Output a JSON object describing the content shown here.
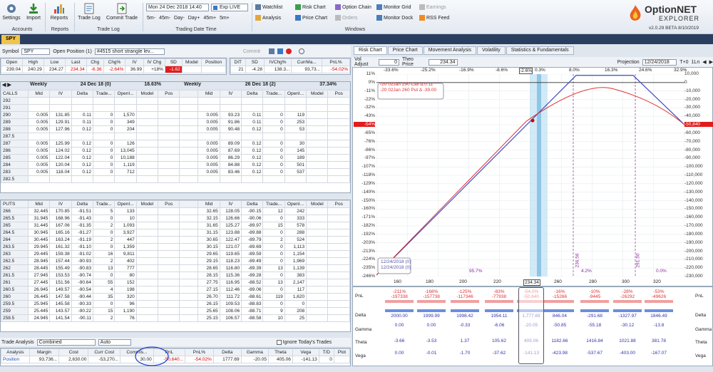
{
  "ribbon": {
    "accounts": {
      "group": "Accounts",
      "settings": "Settings",
      "import": "Import"
    },
    "reports": {
      "group": "Reports",
      "reports": "Reports"
    },
    "tradelog": {
      "group": "Trade Log",
      "tradelog": "Trade Log",
      "committrade": "Commit Trade"
    },
    "tradingdate": {
      "group": "Trading Date  Time",
      "date": "Mon 24 Dec 2018 14:40",
      "exp": "Exp LIVE",
      "steps": [
        "5m-",
        "45m-",
        "Day-",
        "Day+",
        "45m+",
        "5m+"
      ]
    },
    "windows": {
      "group": "Windows",
      "items": [
        "Watchlist",
        "Analysis",
        "Risk Chart",
        "Price Chart",
        "Option Chain",
        "Orders",
        "Monitor Grid",
        "Monitor Dock",
        "Earnings",
        "RSS Feed"
      ]
    },
    "brand": {
      "line1": "OptionNET",
      "line2": "EXPLORER",
      "version": "v2.0.29 BETA 8/10/2019"
    }
  },
  "tab": "SPY",
  "symbolbar": {
    "symbol_label": "Symbol",
    "symbol": "SPY",
    "open_position_label": "Open Position (1)",
    "position": "#4515 short strangle lev...",
    "commit": "Commit"
  },
  "quote": {
    "headers": [
      "Open",
      "High",
      "Low",
      "Last",
      "Chg",
      "Chg%",
      "IV",
      "IV Chg",
      "SD",
      "Model",
      "Position"
    ],
    "values": [
      "239.04",
      "240.29",
      "234.27",
      "234.34",
      "-6.36",
      "-2.64%",
      "36.99",
      "+18%",
      "-1.62",
      "",
      ""
    ]
  },
  "posinfo": {
    "headers": [
      "DIT",
      "SD",
      "IVChg%",
      "CurrMa...",
      "PnL%"
    ],
    "values": [
      "21",
      "-4.28",
      "138.3...",
      "93,73...",
      "-54.02%"
    ]
  },
  "calls": {
    "label": "CALLS",
    "left_title": "Weekly",
    "left_exp": "24 Dec 18 (0)",
    "left_pct": "18.63%",
    "right_title": "Weekly",
    "right_exp": "26 Dec 18 (2)",
    "right_pct": "37.34%",
    "headers": [
      "Mid",
      "IV",
      "Delta",
      "Trade...",
      "OpenI...",
      "Model",
      "Pos"
    ],
    "rows": [
      {
        "strike": "292",
        "l": [
          "",
          "",
          "",
          "",
          "",
          "",
          ""
        ],
        "r": [
          "",
          "",
          "",
          "",
          "",
          "",
          ""
        ]
      },
      {
        "strike": "291",
        "l": [
          "",
          "",
          "",
          "",
          "",
          "",
          ""
        ],
        "r": [
          "",
          "",
          "",
          "",
          "",
          "",
          ""
        ]
      },
      {
        "strike": "290",
        "l": [
          "0.005",
          "131.85",
          "0.11",
          "0",
          "1,570",
          "",
          ""
        ],
        "r": [
          "0.005",
          "93.23",
          "0.11",
          "0",
          "119",
          "",
          ""
        ]
      },
      {
        "strike": "289",
        "l": [
          "0.005",
          "129.91",
          "0.11",
          "0",
          "349",
          "",
          ""
        ],
        "r": [
          "0.005",
          "91.86",
          "0.11",
          "0",
          "253",
          "",
          ""
        ]
      },
      {
        "strike": "288",
        "l": [
          "0.005",
          "127.96",
          "0.12",
          "0",
          "204",
          "",
          ""
        ],
        "r": [
          "0.005",
          "90.48",
          "0.12",
          "0",
          "53",
          "",
          ""
        ]
      },
      {
        "strike": "287.5",
        "l": [
          "",
          "",
          "",
          "",
          "",
          "",
          ""
        ],
        "r": [
          "",
          "",
          "",
          "",
          "",
          "",
          ""
        ]
      },
      {
        "strike": "287",
        "l": [
          "0.005",
          "125.99",
          "0.12",
          "0",
          "126",
          "",
          ""
        ],
        "r": [
          "0.005",
          "89.09",
          "0.12",
          "0",
          "30",
          "",
          ""
        ]
      },
      {
        "strike": "286",
        "l": [
          "0.005",
          "124.02",
          "0.12",
          "0",
          "13,045",
          "",
          ""
        ],
        "r": [
          "0.005",
          "87.69",
          "0.12",
          "0",
          "145",
          "",
          ""
        ]
      },
      {
        "strike": "285",
        "l": [
          "0.005",
          "122.04",
          "0.12",
          "0",
          "10,188",
          "",
          ""
        ],
        "r": [
          "0.005",
          "86.29",
          "0.12",
          "0",
          "189",
          "",
          ""
        ]
      },
      {
        "strike": "284",
        "l": [
          "0.005",
          "120.04",
          "0.12",
          "0",
          "1,119",
          "",
          ""
        ],
        "r": [
          "0.005",
          "84.88",
          "0.12",
          "0",
          "501",
          "",
          ""
        ]
      },
      {
        "strike": "283",
        "l": [
          "0.005",
          "118.04",
          "0.12",
          "0",
          "712",
          "",
          ""
        ],
        "r": [
          "0.005",
          "83.46",
          "0.12",
          "0",
          "537",
          "",
          ""
        ]
      },
      {
        "strike": "282.5",
        "l": [
          "",
          "",
          "",
          "",
          "",
          "",
          ""
        ],
        "r": [
          "",
          "",
          "",
          "",
          "",
          "",
          ""
        ]
      }
    ]
  },
  "puts": {
    "label": "PUTS",
    "headers": [
      "Mid",
      "IV",
      "Delta",
      "Trade...",
      "OpenI...",
      "Model",
      "Pos"
    ],
    "rows": [
      {
        "strike": "266",
        "l": [
          "32.445",
          "170.85",
          "-91.51",
          "5",
          "133",
          "",
          ""
        ],
        "r": [
          "32.65",
          "128.05",
          "-90.15",
          "12",
          "242",
          "",
          ""
        ]
      },
      {
        "strike": "265.5",
        "l": [
          "31.945",
          "168.96",
          "-91.43",
          "0",
          "10",
          "",
          ""
        ],
        "r": [
          "32.15",
          "126.66",
          "-90.06",
          "0",
          "333",
          "",
          ""
        ]
      },
      {
        "strike": "265",
        "l": [
          "31.445",
          "167.06",
          "-91.35",
          "2",
          "1,093",
          "",
          ""
        ],
        "r": [
          "31.65",
          "125.27",
          "-89.97",
          "15",
          "578",
          "",
          ""
        ]
      },
      {
        "strike": "264.5",
        "l": [
          "30.945",
          "165.16",
          "-91.27",
          "0",
          "3,927",
          "",
          ""
        ],
        "r": [
          "31.15",
          "123.88",
          "-89.88",
          "0",
          "288",
          "",
          ""
        ]
      },
      {
        "strike": "264",
        "l": [
          "30.445",
          "163.24",
          "-91.19",
          "2",
          "447",
          "",
          ""
        ],
        "r": [
          "30.65",
          "122.47",
          "-89.79",
          "2",
          "524",
          "",
          ""
        ]
      },
      {
        "strike": "263.5",
        "l": [
          "29.945",
          "161.32",
          "-91.10",
          "0",
          "1,359",
          "",
          ""
        ],
        "r": [
          "30.15",
          "121.07",
          "-89.69",
          "0",
          "1,113",
          "",
          ""
        ]
      },
      {
        "strike": "263",
        "l": [
          "29.445",
          "159.38",
          "-91.02",
          "16",
          "9,811",
          "",
          ""
        ],
        "r": [
          "29.65",
          "119.65",
          "-89.59",
          "0",
          "1,154",
          "",
          ""
        ]
      },
      {
        "strike": "262.5",
        "l": [
          "28.945",
          "157.44",
          "-90.93",
          "2",
          "402",
          "",
          ""
        ],
        "r": [
          "29.15",
          "118.23",
          "-89.49",
          "0",
          "1,969",
          "",
          ""
        ]
      },
      {
        "strike": "262",
        "l": [
          "28.445",
          "155.49",
          "-90.83",
          "13",
          "777",
          "",
          ""
        ],
        "r": [
          "28.65",
          "116.80",
          "-89.39",
          "13",
          "1,139",
          "",
          ""
        ]
      },
      {
        "strike": "261.5",
        "l": [
          "27.945",
          "153.53",
          "-90.74",
          "0",
          "80",
          "",
          ""
        ],
        "r": [
          "28.15",
          "115.36",
          "-89.28",
          "0",
          "383",
          "",
          ""
        ]
      },
      {
        "strike": "261",
        "l": [
          "27.445",
          "151.56",
          "-90.64",
          "55",
          "152",
          "",
          ""
        ],
        "r": [
          "27.75",
          "116.95",
          "-88.52",
          "13",
          "2,147",
          "",
          ""
        ]
      },
      {
        "strike": "260.5",
        "l": [
          "26.945",
          "149.57",
          "-90.54",
          "4",
          "198",
          "",
          ""
        ],
        "r": [
          "27.15",
          "112.46",
          "-89.06",
          "0",
          "117",
          "",
          ""
        ]
      },
      {
        "strike": "260",
        "l": [
          "26.445",
          "147.58",
          "-90.44",
          "35",
          "320",
          "",
          ""
        ],
        "r": [
          "26.70",
          "111.72",
          "-88.61",
          "119",
          "1,620",
          "",
          ""
        ]
      },
      {
        "strike": "259.5",
        "l": [
          "25.945",
          "145.58",
          "-90.33",
          "0",
          "96",
          "",
          ""
        ],
        "r": [
          "26.15",
          "109.53",
          "-88.83",
          "0",
          "0",
          "",
          ""
        ]
      },
      {
        "strike": "259",
        "l": [
          "25.445",
          "143.57",
          "-90.22",
          "15",
          "1,190",
          "",
          ""
        ],
        "r": [
          "25.65",
          "108.06",
          "-88.71",
          "9",
          "208",
          "",
          ""
        ]
      },
      {
        "strike": "258.5",
        "l": [
          "24.945",
          "141.54",
          "-90.11",
          "2",
          "76",
          "",
          ""
        ],
        "r": [
          "25.15",
          "106.57",
          "-88.58",
          "10",
          "25",
          "",
          ""
        ]
      }
    ]
  },
  "trade": {
    "label": "Trade Analysis",
    "mode": "Combined",
    "auto": "Auto",
    "ignore": "Ignore Today's Trades",
    "headers": [
      "Analysis",
      "Margin",
      "Cost",
      "Curr Cost",
      "Commis...",
      "PnL",
      "PnL%",
      "Delta",
      "Gamma",
      "Theta",
      "Vega",
      "T/D",
      "Plot"
    ],
    "values": [
      "Position",
      "93,736...",
      "2,630.00",
      "-53,270...",
      "30.00",
      "-50,640...",
      "-54.02%",
      "1777.69",
      "-20.05",
      "405.06",
      "-141.13",
      "0",
      ""
    ]
  },
  "risk": {
    "tabs": [
      "Risk Chart",
      "Price Chart",
      "Movement Analysis",
      "Volatility",
      "Statistics & Fundamentals"
    ],
    "vol_label": "Vol Adjust",
    "vol": "0",
    "theo_label": "Theo Price",
    "theo": "234.34",
    "proj_label": "Projection",
    "proj": "12/24/2018",
    "tplus": "T+0",
    "step": "1Ln",
    "top_pct": [
      "-33.6%",
      "-25.2%",
      "-16.9%",
      "-8.6%",
      "-2.6%",
      "0.3%",
      "8.0%",
      "16.3%",
      "24.6%",
      "32.9%"
    ],
    "y_left": [
      "11%",
      "0%",
      "-11%",
      "-22%",
      "-32%",
      "-43%",
      "-54%",
      "-65%",
      "-76%",
      "-86%",
      "-97%",
      "-107%",
      "-118%",
      "-129%",
      "-140%",
      "-150%",
      "-160%",
      "-171%",
      "-182%",
      "-192%",
      "-203%",
      "-213%",
      "-224%",
      "-235%",
      "-246%"
    ],
    "y_right": [
      "10,000",
      "0",
      "-10,000",
      "-20,000",
      "-30,000",
      "-40,000",
      "-50,840",
      "-60,000",
      "-70,000",
      "-80,000",
      "-90,000",
      "-100,000",
      "-110,000",
      "-120,000",
      "-130,000",
      "-140,000",
      "-150,000",
      "-160,000",
      "-170,000",
      "-180,000",
      "-190,000",
      "-200,000",
      "-210,000",
      "-220,000",
      "-230,000"
    ],
    "x": [
      "160",
      "180",
      "200",
      "220",
      "234.34",
      "260",
      "280",
      "300",
      "320"
    ],
    "legend": [
      "-20 02Jan 290 Call Δ 0.11",
      "-20 02Jan 260 Put Δ -39.00"
    ],
    "dates": [
      "12/24/2018 (0)",
      "12/24/2018 (0)"
    ],
    "strikes": [
      "236.56",
      "291.50"
    ],
    "bottom_pct": [
      "95.7%",
      "4.2%",
      "0.0%"
    ],
    "cur_pnl": "-54%",
    "cur_val": "-50,840",
    "greeks": {
      "labels": [
        "PnL",
        "Delta",
        "Gamma",
        "Theta",
        "Vega"
      ],
      "pnl_pct": [
        "-211%",
        "-168%",
        "-125%",
        "-83%",
        "-54.0%",
        "-16%",
        "-10%",
        "-28%",
        "-53%"
      ],
      "pnl_vals": [
        "-197338",
        "-157738",
        "-117346",
        "-77938",
        "-50,640",
        "-15266",
        "-9445",
        "-26292",
        "-49626"
      ],
      "delta": [
        "2000.00",
        "1999.99",
        "1998.42",
        "1954.11",
        "1,777.69",
        "846.04",
        "-291.68",
        "-1327.97",
        "1846.49"
      ],
      "gamma": [
        "0.00",
        "0.00",
        "-0.33",
        "-6.06",
        "-20.05",
        "-50.85",
        "-55.18",
        "-30.12",
        "-13.8"
      ],
      "theta": [
        "-3.66",
        "-3.53",
        "1.37",
        "105.62",
        "405.06",
        "1182.66",
        "1416.84",
        "1021.88",
        "381.78"
      ],
      "vega": [
        "0.00",
        "-0.01",
        "-1.70",
        "-37.62",
        "-141.13",
        "-423.98",
        "-537.67",
        "-403.00",
        "-167.07"
      ]
    }
  }
}
